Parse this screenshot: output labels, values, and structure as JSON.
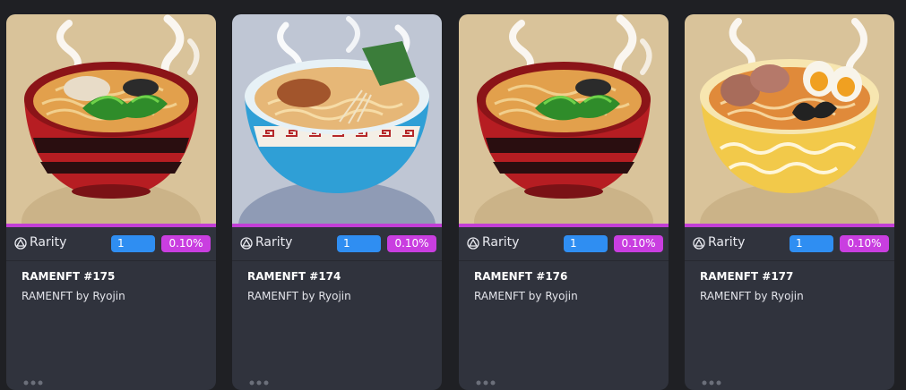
{
  "colors": {
    "accent": "#c23ed6",
    "rank_badge": "#2f8ef2",
    "pct_badge": "#c93ee0",
    "card_bg": "#30333d",
    "page_bg": "#1f2024"
  },
  "cards": [
    {
      "art": "red-bowl-ramen",
      "rarity_label": "Rarity",
      "rank": "1",
      "percent": "0.10%",
      "title": "RAMENFT #175",
      "creator": "RAMENFT by Ryojin"
    },
    {
      "art": "blue-bowl-ramen",
      "rarity_label": "Rarity",
      "rank": "1",
      "percent": "0.10%",
      "title": "RAMENFT #174",
      "creator": "RAMENFT by Ryojin"
    },
    {
      "art": "red-bowl-ramen",
      "rarity_label": "Rarity",
      "rank": "1",
      "percent": "0.10%",
      "title": "RAMENFT #176",
      "creator": "RAMENFT by Ryojin"
    },
    {
      "art": "yellow-bowl-ramen",
      "rarity_label": "Rarity",
      "rank": "1",
      "percent": "0.10%",
      "title": "RAMENFT #177",
      "creator": "RAMENFT by Ryojin"
    }
  ]
}
